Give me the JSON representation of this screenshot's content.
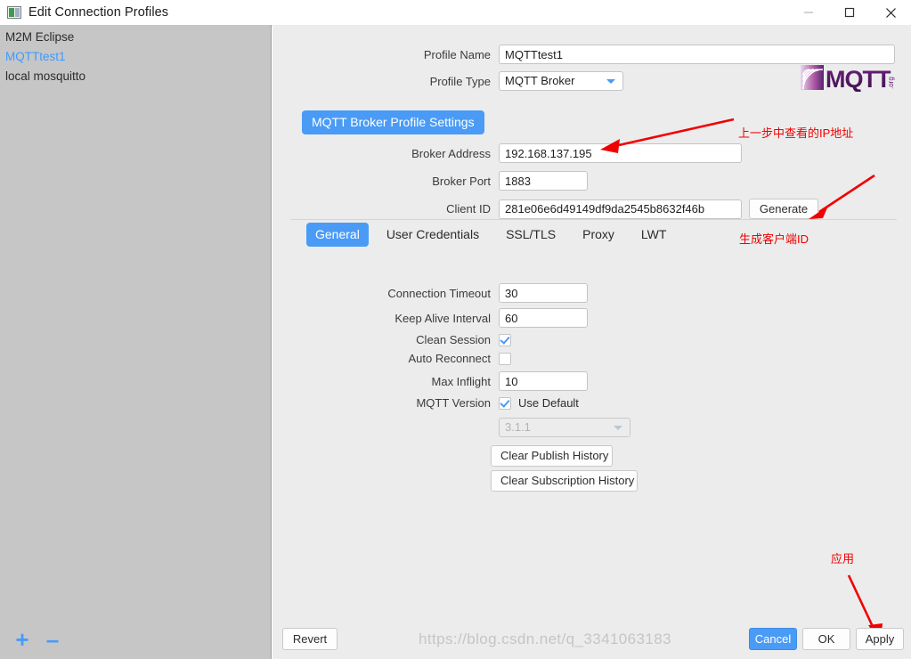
{
  "window": {
    "title": "Edit Connection Profiles",
    "icon": "app-window-icon",
    "minimize_label": "—",
    "maximize_label": "□",
    "close_label": "✕"
  },
  "sidebar": {
    "profiles": [
      {
        "label": "M2M Eclipse",
        "selected": false
      },
      {
        "label": "MQTTtest1",
        "selected": true
      },
      {
        "label": "local mosquitto",
        "selected": false
      }
    ],
    "add_label": "+",
    "remove_label": "–"
  },
  "form": {
    "profile_name_label": "Profile Name",
    "profile_name_value": "MQTTtest1",
    "profile_type_label": "Profile Type",
    "profile_type_value": "MQTT Broker"
  },
  "section": {
    "heading": "MQTT Broker Profile Settings",
    "broker_address_label": "Broker Address",
    "broker_address_value": "192.168.137.195",
    "broker_port_label": "Broker Port",
    "broker_port_value": "1883",
    "client_id_label": "Client ID",
    "client_id_value": "281e06e6d49149df9da2545b8632f46b",
    "generate_label": "Generate"
  },
  "tabs": [
    {
      "label": "General",
      "active": true
    },
    {
      "label": "User Credentials",
      "active": false
    },
    {
      "label": "SSL/TLS",
      "active": false
    },
    {
      "label": "Proxy",
      "active": false
    },
    {
      "label": "LWT",
      "active": false
    }
  ],
  "general": {
    "connection_timeout_label": "Connection Timeout",
    "connection_timeout_value": "30",
    "keep_alive_label": "Keep Alive Interval",
    "keep_alive_value": "60",
    "clean_session_label": "Clean Session",
    "clean_session_checked": true,
    "auto_reconnect_label": "Auto Reconnect",
    "auto_reconnect_checked": false,
    "max_inflight_label": "Max Inflight",
    "max_inflight_value": "10",
    "mqtt_version_label": "MQTT Version",
    "use_default_label": "Use Default",
    "use_default_checked": true,
    "version_value": "3.1.1",
    "clear_publish_label": "Clear Publish History",
    "clear_subscription_label": "Clear Subscription History"
  },
  "footer": {
    "revert_label": "Revert",
    "cancel_label": "Cancel",
    "ok_label": "OK",
    "apply_label": "Apply"
  },
  "annotations": [
    {
      "text": "上一步中查看的IP地址"
    },
    {
      "text": "生成客户端ID"
    },
    {
      "text": "应用"
    }
  ],
  "watermark": "https://blog.csdn.net/q_3341063183",
  "colors": {
    "accent": "#4a9bf5",
    "annotation": "#f00000",
    "panel": "#ececec",
    "sidebar": "#c6c6c6"
  }
}
